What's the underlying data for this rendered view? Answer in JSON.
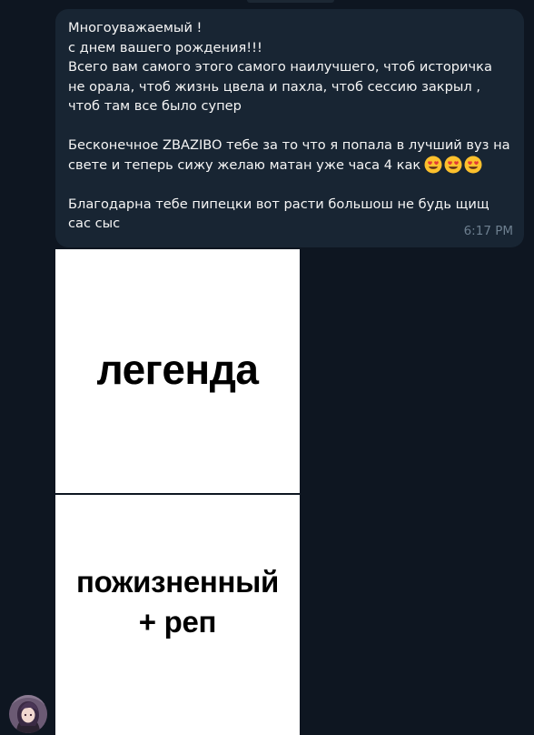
{
  "message": {
    "lines": [
      "Многоуважаемый !",
      "с днем вашего рождения!!!",
      "Всего вам самого этого самого наилучшего, чтоб историчка",
      "не орала, чтоб жизнь цвела и пахла, чтоб сессию закрыл ,",
      "чтоб там все было супер",
      "",
      "Бесконечное ZBAZIBO тебе за то что я попала в лучший вуз на",
      "свете и теперь сижу желаю матан уже часа 4 как",
      "",
      "Благодарна тебе пипецки вот расти большош не будь щищ",
      "сас сыс"
    ],
    "emoji": [
      "smiling-face-with-heart-eyes",
      "smiling-face-with-heart-eyes",
      "smiling-face-with-heart-eyes"
    ],
    "time": "6:17 PM"
  },
  "media": {
    "top_caption": "легенда",
    "bottom_caption_line1": "пожизненный",
    "bottom_caption_line2": "+ реп"
  },
  "colors": {
    "background": "#0e1621",
    "bubble": "#182533",
    "text": "#f5f5f5",
    "time": "#6d7f8f"
  }
}
